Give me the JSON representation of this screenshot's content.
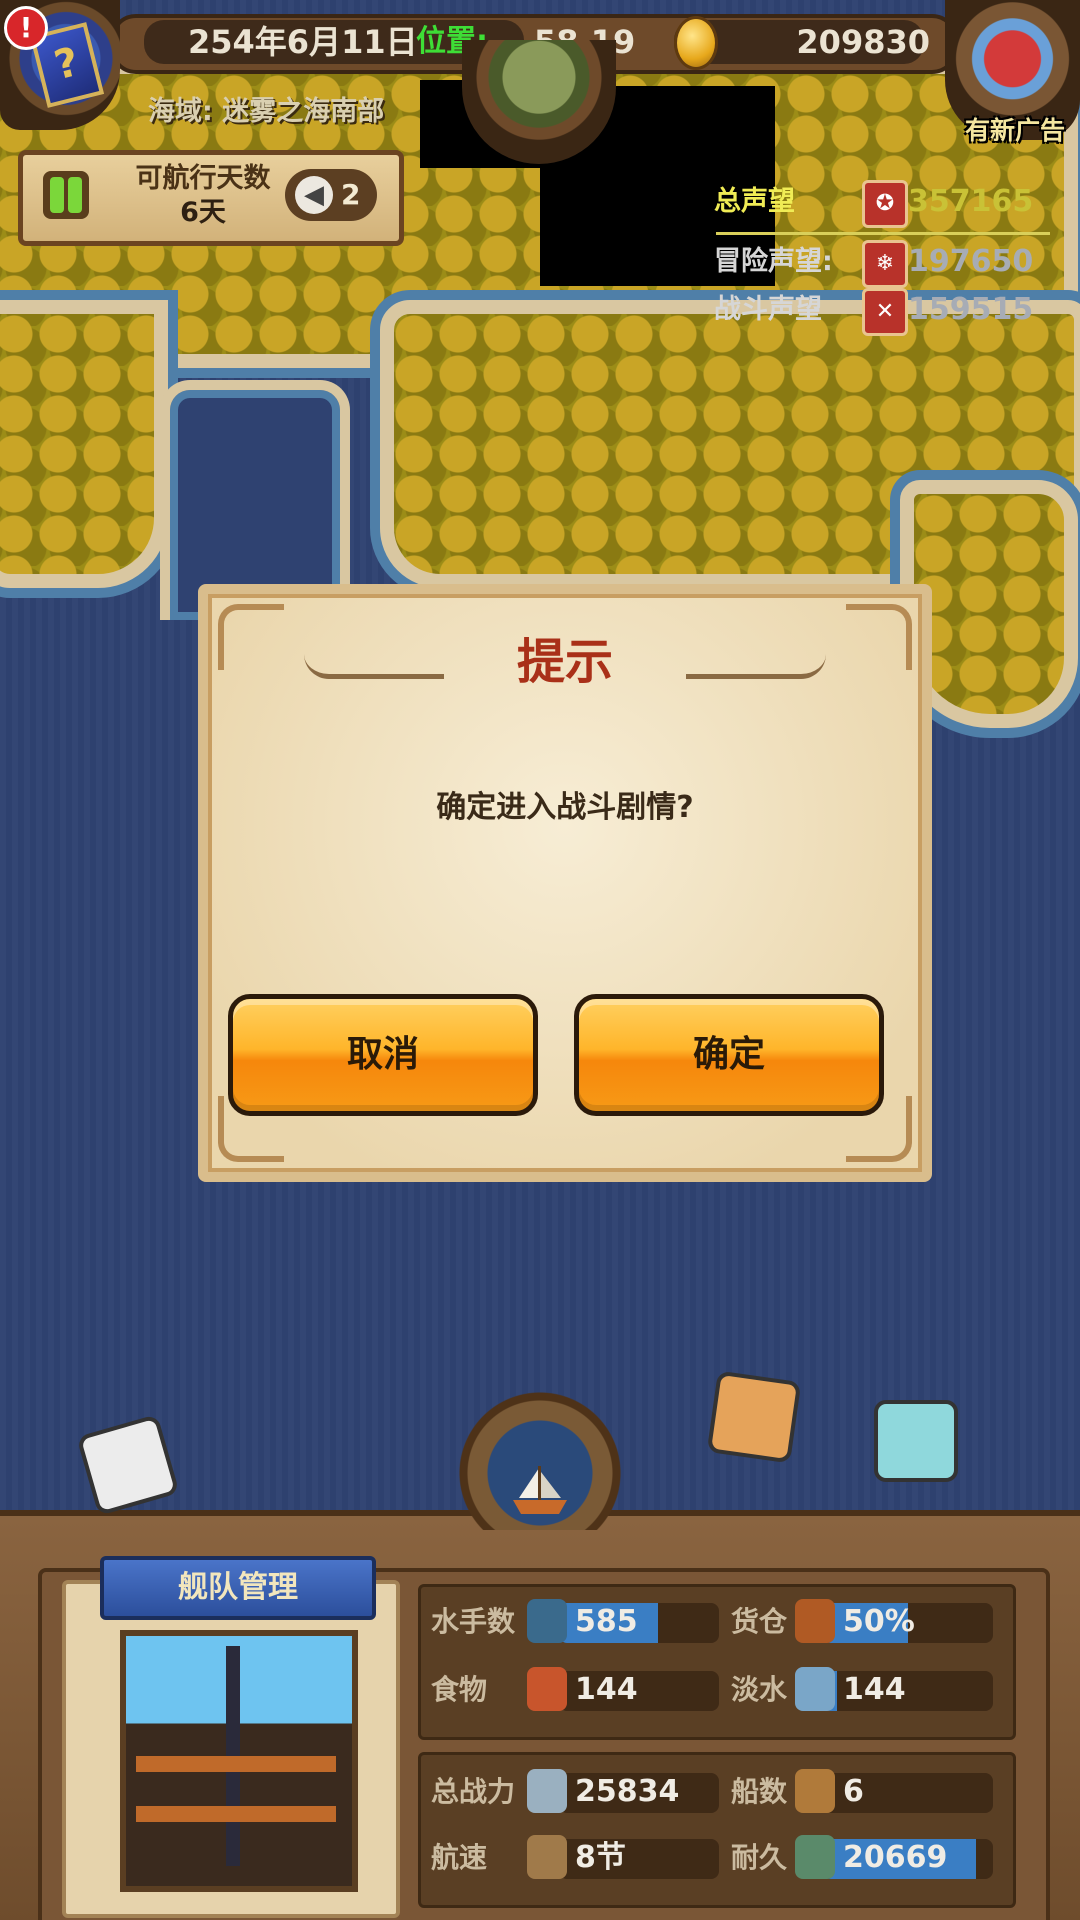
{
  "top_bar": {
    "date": "254年6月11日",
    "position_label": "位置:",
    "position_value": "58,19",
    "gold": "209830",
    "alert_mark": "!",
    "book_mark": "?",
    "region": "海域: 迷雾之海南部",
    "ad_label": "有新广告"
  },
  "sailing": {
    "title": "可航行天数",
    "days": "6天",
    "speed": "2",
    "speed_arrow": "◀"
  },
  "reputation": {
    "total_label": "总声望",
    "total_value": "357165",
    "adventure_label": "冒险声望:",
    "adventure_value": "197650",
    "battle_label": "战斗声望",
    "battle_value": "159515",
    "badge_total": "✪",
    "badge_adventure": "❄",
    "badge_battle": "✕"
  },
  "dialog": {
    "title": "提示",
    "message": "确定进入战斗剧情?",
    "cancel_label": "取消",
    "confirm_label": "确定"
  },
  "fleet": {
    "title": "舰队管理",
    "stats_top": [
      {
        "label": "水手数",
        "value": "585",
        "fill": 0.62,
        "icon": "sailor-icon",
        "color": "#3a7ec4"
      },
      {
        "label": "货仓",
        "value": "50%",
        "fill": 0.5,
        "icon": "cargo-icon",
        "color": "#3a7ec4"
      },
      {
        "label": "食物",
        "value": "144",
        "fill": 0.0,
        "icon": "meat-icon",
        "color": "#3a7ec4"
      },
      {
        "label": "淡水",
        "value": "144",
        "fill": 0.08,
        "icon": "water-jug-icon",
        "color": "#3a7ec4"
      }
    ],
    "stats_bottom": [
      {
        "label": "总战力",
        "value": "25834",
        "fill": 0.0,
        "icon": "swords-icon",
        "color": "#3a7ec4"
      },
      {
        "label": "船数",
        "value": "6",
        "fill": 0.0,
        "icon": "ship-count-icon",
        "color": "#3a7ec4"
      },
      {
        "label": "航速",
        "value": "8节",
        "fill": 0.0,
        "icon": "sail-icon",
        "color": "#3a7ec4"
      },
      {
        "label": "耐久",
        "value": "20669",
        "fill": 0.9,
        "icon": "durability-icon",
        "color": "#3a7ec4"
      }
    ]
  },
  "colors": {
    "sea": "#2f4271",
    "gold_text": "#c9c236",
    "button_orange": "#f6870c",
    "dialog_title": "#a93018"
  }
}
